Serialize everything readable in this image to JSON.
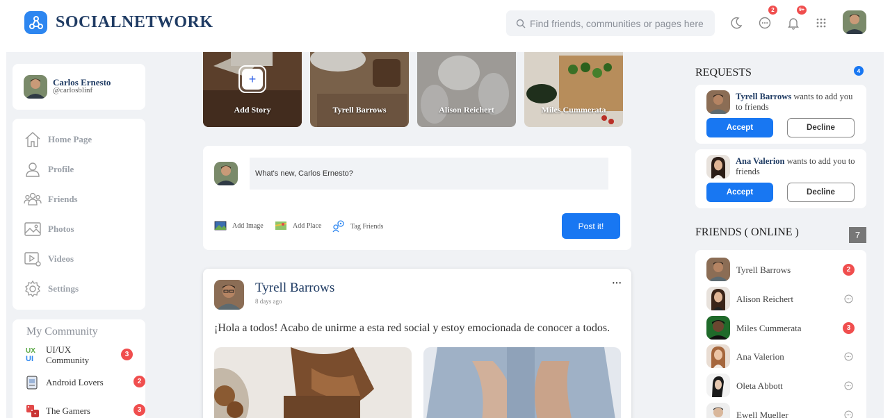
{
  "header": {
    "logo_text": "SOCIALNETWORK",
    "search_placeholder": "Find friends, communities or pages here",
    "messages_badge": "2",
    "notifications_badge": "9+"
  },
  "profile": {
    "name": "Carlos Ernesto",
    "handle": "@carlosblinf"
  },
  "nav": [
    {
      "label": "Home Page",
      "icon": "home-icon"
    },
    {
      "label": "Profile",
      "icon": "user-icon"
    },
    {
      "label": "Friends",
      "icon": "friends-icon"
    },
    {
      "label": "Photos",
      "icon": "photos-icon"
    },
    {
      "label": "Videos",
      "icon": "videos-icon"
    },
    {
      "label": "Settings",
      "icon": "settings-icon"
    }
  ],
  "community": {
    "title": "My Community",
    "items": [
      {
        "label": "UI/UX Community",
        "badge": "3"
      },
      {
        "label": "Android Lovers",
        "badge": "2"
      },
      {
        "label": "The Gamers",
        "badge": "3"
      }
    ]
  },
  "stories": [
    {
      "name": "Add Story"
    },
    {
      "name": "Tyrell Barrows"
    },
    {
      "name": "Alison Reichert"
    },
    {
      "name": "Miles Cummerata"
    }
  ],
  "composer": {
    "placeholder": "What's new, Carlos Ernesto?",
    "add_image": "Add Image",
    "add_place": "Add Place",
    "tag_friends": "Tag Friends",
    "post_button": "Post it!"
  },
  "post": {
    "author": "Tyrell Barrows",
    "time": "8 days ago",
    "more": "···",
    "text": "¡Hola a todos! Acabo de unirme a esta red social y estoy emocionada de conocer a todos."
  },
  "requests": {
    "title": "REQUESTS",
    "badge": "4",
    "items": [
      {
        "name": "Tyrell Barrows",
        "message": " wants to add you to friends",
        "accept": "Accept",
        "decline": "Decline"
      },
      {
        "name": "Ana Valerion",
        "message": " wants to add you to friends",
        "accept": "Accept",
        "decline": "Decline"
      }
    ]
  },
  "friends": {
    "title": "FRIENDS ( ONLINE )",
    "count": "7",
    "items": [
      {
        "name": "Tyrell Barrows",
        "badge": "2"
      },
      {
        "name": "Alison Reichert",
        "badge": ""
      },
      {
        "name": "Miles Cummerata",
        "badge": "3"
      },
      {
        "name": "Ana Valerion",
        "badge": ""
      },
      {
        "name": "Oleta Abbott",
        "badge": ""
      },
      {
        "name": "Ewell Mueller",
        "badge": ""
      }
    ]
  }
}
